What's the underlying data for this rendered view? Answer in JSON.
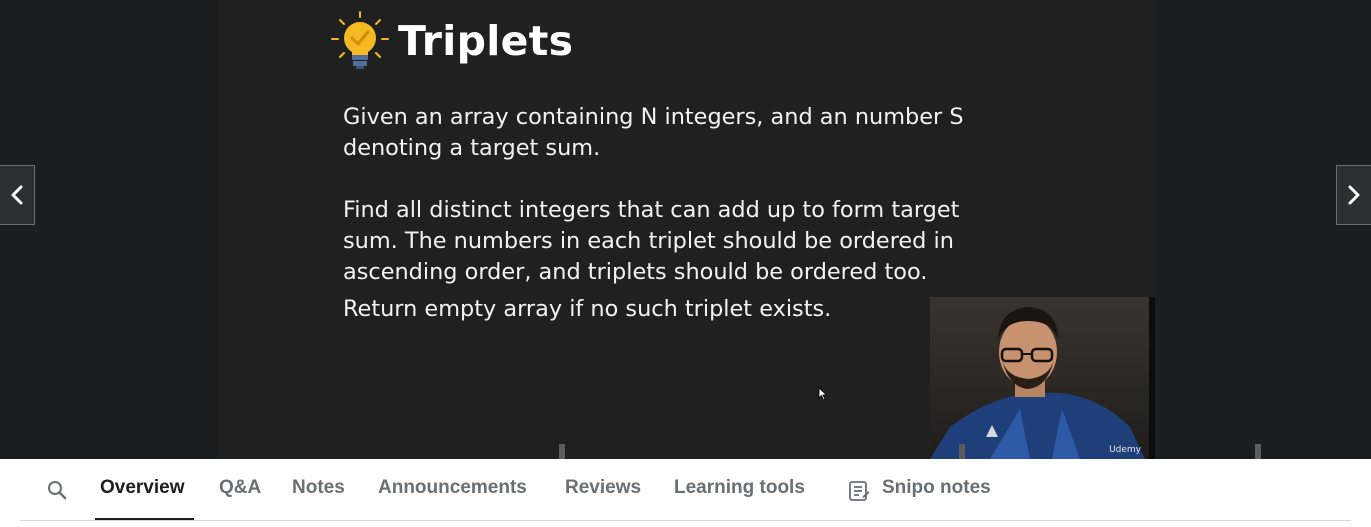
{
  "slide": {
    "title": "Triplets",
    "icon": "lightbulb-check-icon",
    "paragraphs": [
      "Given an array containing N integers, and an number S denoting a target sum.",
      "Find all distinct integers that can add up to form target sum. The numbers in each triplet should be ordered in ascending order, and triplets should be ordered too.",
      "Return empty array if no such triplet exists."
    ]
  },
  "webcam": {
    "logo": "Udemy"
  },
  "navigation": {
    "prev_icon": "chevron-left-icon",
    "next_icon": "chevron-right-icon"
  },
  "tabs": {
    "search_icon": "search-icon",
    "items": [
      "Overview",
      "Q&A",
      "Notes",
      "Announcements",
      "Reviews",
      "Learning tools",
      "Snipo notes"
    ],
    "active": "Overview",
    "snipo_icon": "notes-list-icon"
  },
  "colors": {
    "player_bg": "#1c1d1f",
    "slide_bg": "#202020",
    "bulb_yellow": "#f5b921",
    "active_tab": "#1c1d1f",
    "inactive_tab": "#6a6f73"
  }
}
